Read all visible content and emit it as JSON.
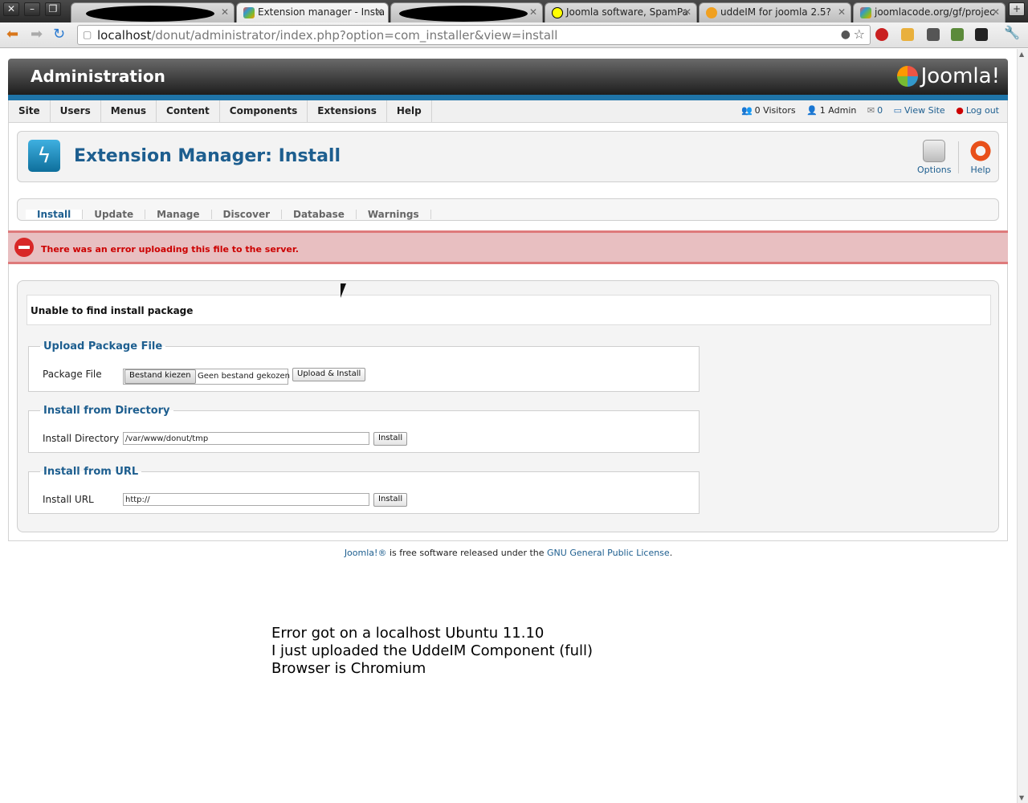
{
  "browser": {
    "tabs": [
      {
        "label": "",
        "redacted": true
      },
      {
        "label": "Extension manager - Insta",
        "active": true
      },
      {
        "label": "",
        "redacted": true
      },
      {
        "label": "Joomla software, SpamPa"
      },
      {
        "label": "uddeIM for joomla 2.5?"
      },
      {
        "label": "joomlacode.org/gf/projec"
      }
    ],
    "url_host": "localhost",
    "url_path": "/donut/administrator/index.php?option=com_installer&view=install",
    "window_controls": [
      "close-icon",
      "minimize-icon",
      "maximize-icon"
    ]
  },
  "admin": {
    "header_title": "Administration",
    "logo_text": "Joomla!",
    "menu": [
      "Site",
      "Users",
      "Menus",
      "Content",
      "Components",
      "Extensions",
      "Help"
    ],
    "status": {
      "visitors": "0 Visitors",
      "admins": "1 Admin",
      "messages": "0",
      "view_site": "View Site",
      "logout": "Log out"
    },
    "page_title": "Extension Manager: Install",
    "toolbar": {
      "options": "Options",
      "help": "Help"
    },
    "subtabs": [
      "Install",
      "Update",
      "Manage",
      "Discover",
      "Database",
      "Warnings"
    ],
    "error_message": "There was an error uploading this file to the server.",
    "notice": "Unable to find install package",
    "upload": {
      "legend": "Upload Package File",
      "label": "Package File",
      "choose_button": "Bestand kiezen",
      "no_file": "Geen bestand gekozen",
      "submit": "Upload & Install"
    },
    "directory": {
      "legend": "Install from Directory",
      "label": "Install Directory",
      "value": "/var/www/donut/tmp",
      "submit": "Install"
    },
    "url": {
      "legend": "Install from URL",
      "label": "Install URL",
      "value": "http://",
      "submit": "Install"
    },
    "footer": {
      "link1": "Joomla!®",
      "text": " is free software released under the ",
      "link2": "GNU General Public License",
      "end": "."
    }
  },
  "annotation": [
    "Error got on a localhost Ubuntu 11.10",
    "I just uploaded the UddeIM Component (full)",
    "Browser is Chromium"
  ],
  "colors": {
    "accent": "#1d5e8f",
    "error": "#cc0000",
    "blue_bar": "#1f74a8"
  }
}
